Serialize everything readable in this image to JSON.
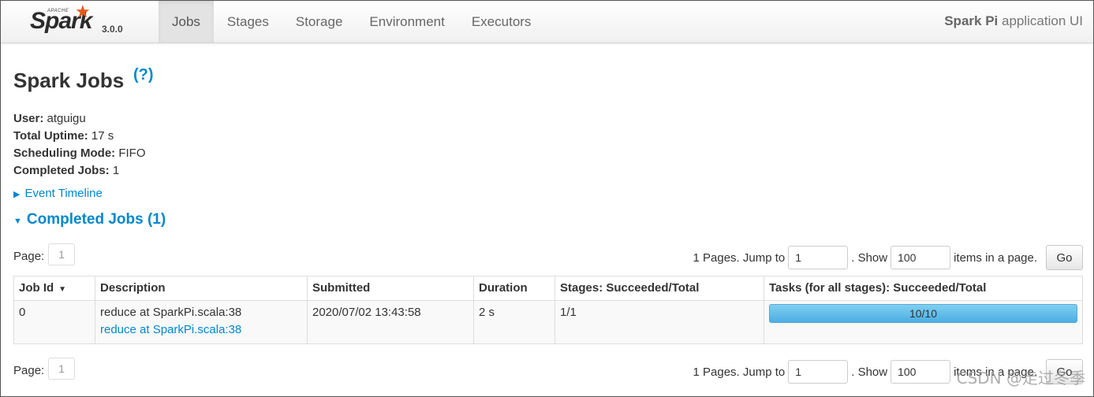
{
  "brand": {
    "apache": "APACHE",
    "name": "Spark",
    "version": "3.0.0"
  },
  "nav": {
    "tabs": [
      "Jobs",
      "Stages",
      "Storage",
      "Environment",
      "Executors"
    ],
    "active": "Jobs"
  },
  "app_name": {
    "bold": "Spark Pi",
    "rest": " application UI"
  },
  "page": {
    "title": "Spark Jobs",
    "help": "(?)"
  },
  "info": {
    "user_label": "User:",
    "user_value": " atguigu",
    "uptime_label": "Total Uptime:",
    "uptime_value": " 17 s",
    "mode_label": "Scheduling Mode:",
    "mode_value": " FIFO",
    "completed_label": "Completed Jobs:",
    "completed_value": " 1"
  },
  "event_timeline": "Event Timeline",
  "completed_section": "Completed Jobs (1)",
  "paging": {
    "page_label": "Page:",
    "page_number": "1",
    "pages_text": "1 Pages. Jump to",
    "jump_value": "1",
    "show_text": ". Show",
    "show_value": "100",
    "items_text": "items in a page.",
    "go_label": "Go"
  },
  "table": {
    "headers": {
      "job_id": "Job Id",
      "description": "Description",
      "submitted": "Submitted",
      "duration": "Duration",
      "stages": "Stages: Succeeded/Total",
      "tasks": "Tasks (for all stages): Succeeded/Total"
    },
    "rows": [
      {
        "job_id": "0",
        "description": "reduce at SparkPi.scala:38",
        "description_link": "reduce at SparkPi.scala:38",
        "submitted": "2020/07/02 13:43:58",
        "duration": "2 s",
        "stages": "1/1",
        "tasks": "10/10",
        "tasks_completed_fraction": 1.0
      }
    ]
  },
  "watermark": "CSDN @走过冬季"
}
